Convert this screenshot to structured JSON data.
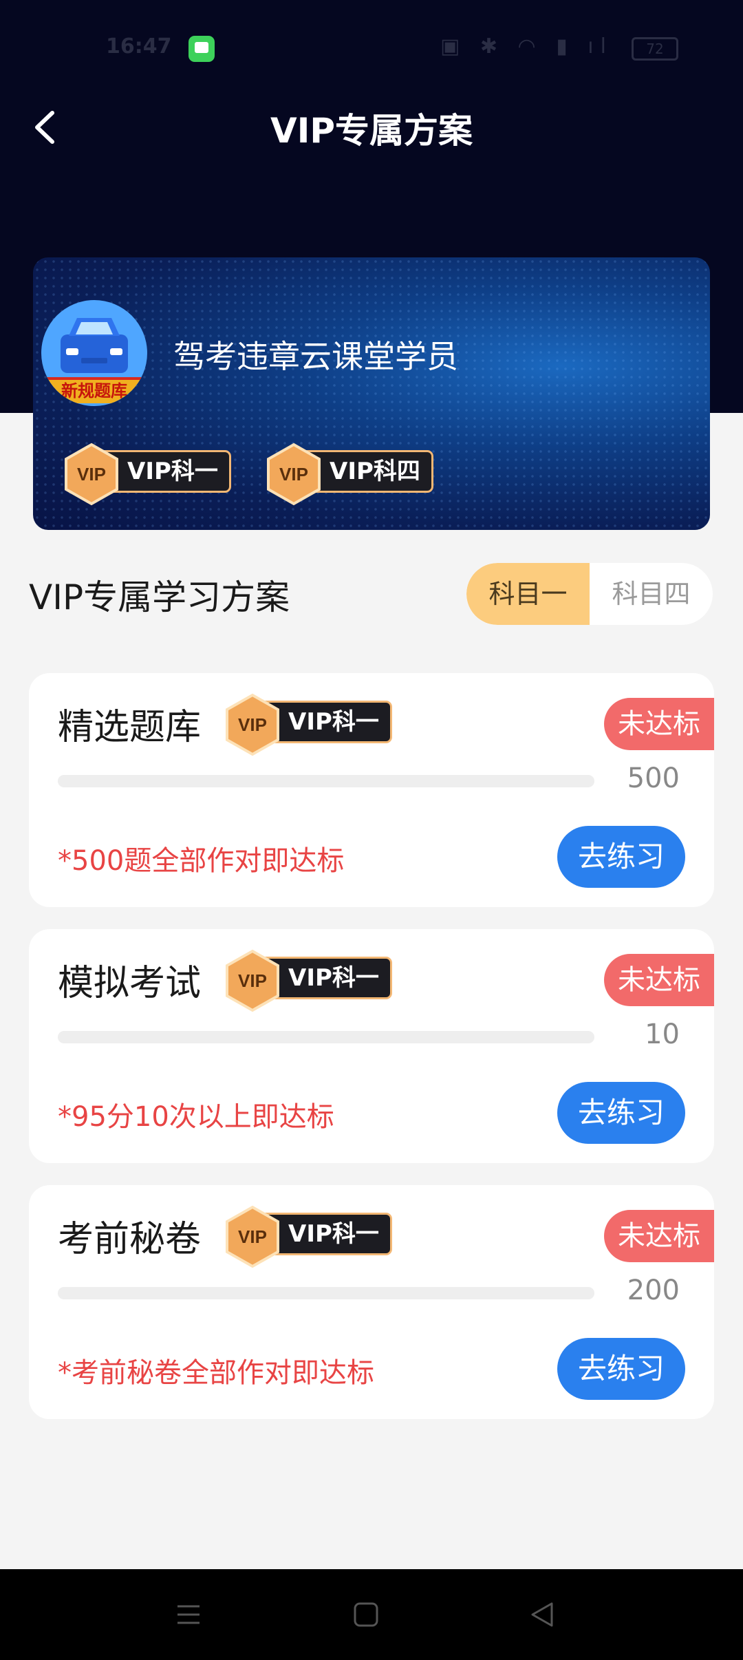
{
  "status_bar": {
    "time": "16:47",
    "battery": "72"
  },
  "header": {
    "title": "VIP专属方案"
  },
  "member_card": {
    "avatar_ribbon": "新规题库",
    "username": "驾考违章云课堂学员",
    "badges": [
      {
        "label": "VIP科一"
      },
      {
        "label": "VIP科四"
      }
    ]
  },
  "section": {
    "title": "VIP专属学习方案",
    "tabs": [
      {
        "label": "科目一",
        "selected": true
      },
      {
        "label": "科目四",
        "selected": false
      }
    ]
  },
  "plans": [
    {
      "name": "精选题库",
      "badge": "VIP科一",
      "status": "未达标",
      "target": "500",
      "progress": 0,
      "requirement": "*500题全部作对即达标",
      "action": "去练习"
    },
    {
      "name": "模拟考试",
      "badge": "VIP科一",
      "status": "未达标",
      "target": "10",
      "progress": 0,
      "requirement": "*95分10次以上即达标",
      "action": "去练习"
    },
    {
      "name": "考前秘卷",
      "badge": "VIP科一",
      "status": "未达标",
      "target": "200",
      "progress": 0,
      "requirement": "*考前秘卷全部作对即达标",
      "action": "去练习"
    }
  ],
  "colors": {
    "header_bg": "#050720",
    "accent_blue": "#2a80ee",
    "status_red": "#f26a6a",
    "tab_selected": "#fccc7e"
  },
  "icons": {
    "back": "back-arrow-icon",
    "vip": "vip-hexagon-icon",
    "nav": [
      "menu-icon",
      "home-square-icon",
      "back-triangle-icon"
    ]
  }
}
